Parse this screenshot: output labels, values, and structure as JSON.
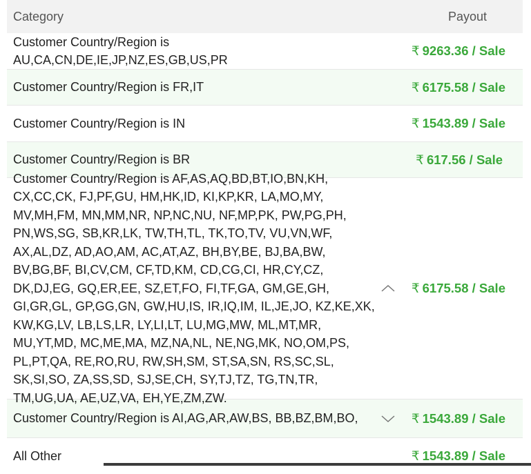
{
  "header": {
    "category": "Category",
    "payout": "Payout"
  },
  "currency_symbol": "₹",
  "rows": [
    {
      "category": "Customer Country/Region is AU,CA,CN,DE,IE,JP,NZ,ES,GB,US,PR",
      "payout": "9263.36 / Sale"
    },
    {
      "category": "Customer Country/Region is FR,IT",
      "payout": "6175.58 / Sale"
    },
    {
      "category": "Customer Country/Region is IN",
      "payout": "1543.89 / Sale"
    },
    {
      "category": "Customer Country/Region is BR",
      "payout": "617.56 / Sale"
    },
    {
      "category": "Customer Country/Region is AF,AS,AQ,BD,BT,IO,BN,KH, CX,CC,CK, FJ,PF,GU, HM,HK,ID, KI,KP,KR, LA,MO,MY, MV,MH,FM, MN,MM,NR, NP,NC,NU, NF,MP,PK, PW,PG,PH, PN,WS,SG, SB,KR,LK, TW,TH,TL, TK,TO,TV, VU,VN,WF, AX,AL,DZ, AD,AO,AM, AC,AT,AZ, BH,BY,BE, BJ,BA,BW, BV,BG,BF, BI,CV,CM, CF,TD,KM, CD,CG,CI, HR,CY,CZ, DK,DJ,EG, GQ,ER,EE, SZ,ET,FO, FI,TF,GA, GM,GE,GH, GI,GR,GL, GP,GG,GN, GW,HU,IS, IR,IQ,IM, IL,JE,JO, KZ,KE,XK, KW,KG,LV, LB,LS,LR, LY,LI,LT, LU,MG,MW, ML,MT,MR, MU,YT,MD, MC,ME,MA, MZ,NA,NL, NE,NG,MK, NO,OM,PS, PL,PT,QA, RE,RO,RU, RW,SH,SM, ST,SA,SN, RS,SC,SL, SK,SI,SO, ZA,SS,SD, SJ,SE,CH, SY,TJ,TZ, TG,TN,TR, TM,UG,UA, AE,UZ,VA, EH,YE,ZM,ZW.",
      "payout": "6175.58 / Sale"
    },
    {
      "category": "Customer Country/Region is AI,AG,AR,AW,BS, BB,BZ,BM,BO,",
      "payout": "1543.89 / Sale"
    },
    {
      "category": "All Other",
      "payout": "1543.89 / Sale"
    }
  ]
}
